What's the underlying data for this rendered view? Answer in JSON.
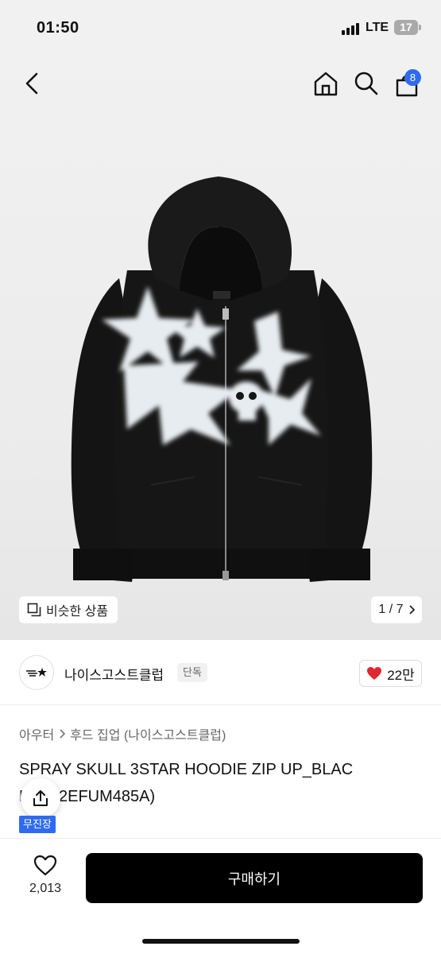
{
  "status": {
    "time": "01:50",
    "network": "LTE",
    "battery": "17"
  },
  "header": {
    "cart_badge": "8"
  },
  "gallery": {
    "similar_label": "비슷한 상품",
    "page_indicator": "1 / 7"
  },
  "brand": {
    "name": "나이스고스트클럽",
    "tag": "단독",
    "likes": "22만"
  },
  "product": {
    "breadcrumb": [
      "아우터",
      "후드 집업 (나이스고스트클럽)"
    ],
    "title_line1": "SPRAY SKULL 3STAR HOODIE ZIP UP_BLAC",
    "title_line2": "K(NG2EFUM485A)",
    "badge": "무진장"
  },
  "bottom": {
    "wish_count": "2,013",
    "buy_label": "구매하기"
  },
  "colors": {
    "accent": "#2f6bf0",
    "like": "#e0282e",
    "buy_button": "#000000"
  }
}
